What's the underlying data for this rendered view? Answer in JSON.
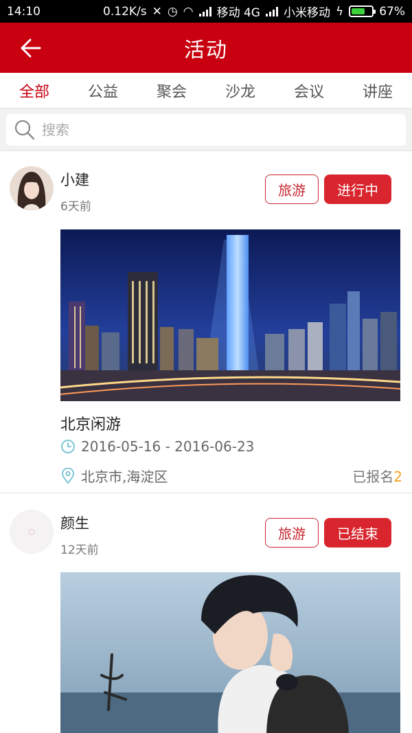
{
  "status_bar": {
    "time": "14:10",
    "speed": "0.12K/s",
    "carrier1": "移动 4G",
    "carrier2": "小米移动",
    "battery": "67%",
    "battery_level": 0.67
  },
  "header": {
    "title": "活动"
  },
  "tabs": [
    {
      "label": "全部",
      "active": true
    },
    {
      "label": "公益",
      "active": false
    },
    {
      "label": "聚会",
      "active": false
    },
    {
      "label": "沙龙",
      "active": false
    },
    {
      "label": "会议",
      "active": false
    },
    {
      "label": "讲座",
      "active": false
    }
  ],
  "search": {
    "placeholder": "搜索"
  },
  "activities": [
    {
      "user": "小建",
      "time": "6天前",
      "tag": "旅游",
      "status": "进行中",
      "title": "北京闲游",
      "date_range": "2016-05-16 - 2016-06-23",
      "location": "北京市,海淀区",
      "signup_label": "已报名",
      "signup_count": "2"
    },
    {
      "user": "颜生",
      "time": "12天前",
      "tag": "旅游",
      "status": "已结束"
    }
  ],
  "colors": {
    "brand": "#c8000f",
    "status_button": "#d9262e",
    "count": "#f0a020"
  }
}
